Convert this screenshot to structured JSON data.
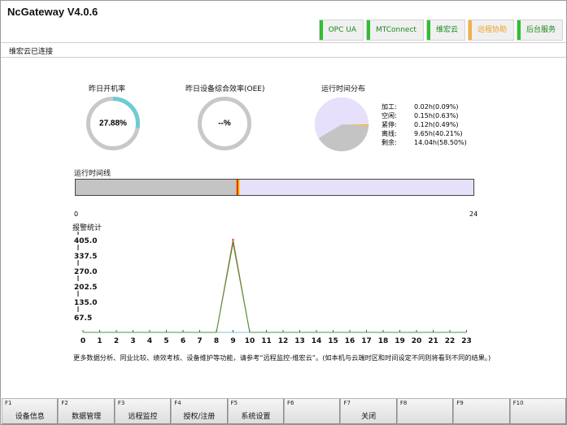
{
  "window": {
    "title": "NcGateway V4.0.6"
  },
  "header": {
    "tabs": [
      {
        "label": "OPC UA",
        "active": false
      },
      {
        "label": "MTConnect",
        "active": false
      },
      {
        "label": "维宏云",
        "active": false
      },
      {
        "label": "远程协助",
        "active": true
      },
      {
        "label": "后台服务",
        "active": false
      }
    ],
    "connection_status": "维宏云已连接"
  },
  "colors": {
    "tab_green": "#2fbf2f",
    "tab_orange": "#f7b040",
    "gauge_track": "#c8c8c8",
    "gauge_fill": "#6ecbd3",
    "idle_gray": "#c4c4c4",
    "remaining_lavender": "#e6e0fb",
    "alarm_red": "#e0522f",
    "alarm_green": "#3f9a3f",
    "baseline_teal": "#7ec3d3"
  },
  "dashboard": {
    "uptime": {
      "caption": "昨日开机率",
      "value_text": "27.88%",
      "fraction": 0.2788
    },
    "oee": {
      "caption": "昨日设备综合效率(OEE)",
      "value_text": "--%"
    },
    "distribution": {
      "caption": "运行时间分布",
      "items": [
        {
          "label": "加工:",
          "value": "0.02h(0.09%)",
          "hours": 0.02,
          "color": "#e03030"
        },
        {
          "label": "空闲:",
          "value": "0.15h(0.63%)",
          "hours": 0.15,
          "color": "#f0a020"
        },
        {
          "label": "紧停:",
          "value": "0.12h(0.49%)",
          "hours": 0.12,
          "color": "#f5d030"
        },
        {
          "label": "离线:",
          "value": "9.65h(40.21%)",
          "hours": 9.65,
          "color": "#c4c4c4"
        },
        {
          "label": "剩余:",
          "value": "14.04h(58.50%)",
          "hours": 14.04,
          "color": "#e6e0fb"
        }
      ]
    }
  },
  "timeline": {
    "caption": "运行时间线",
    "start_label": "0",
    "end_label": "24",
    "segments": [
      {
        "start": 0,
        "end": 9.65,
        "color": "#c4c4c4"
      },
      {
        "start": 9.65,
        "end": 9.72,
        "color": "#f0a020"
      },
      {
        "start": 9.72,
        "end": 9.8,
        "color": "#e03030"
      },
      {
        "start": 9.8,
        "end": 9.92,
        "color": "#f5d030"
      },
      {
        "start": 9.92,
        "end": 24,
        "color": "#e6e0fb"
      }
    ]
  },
  "chart_data": {
    "type": "line",
    "title": "报警统计",
    "xlabel": "",
    "ylabel": "",
    "x": [
      0,
      1,
      2,
      3,
      4,
      5,
      6,
      7,
      8,
      9,
      10,
      11,
      12,
      13,
      14,
      15,
      16,
      17,
      18,
      19,
      20,
      21,
      22,
      23
    ],
    "xlim": [
      0,
      23
    ],
    "ylim": [
      0,
      405
    ],
    "y_ticks": [
      "67.5",
      "135.0",
      "202.5",
      "270.0",
      "337.5",
      "405.0"
    ],
    "series": [
      {
        "color": "#e0522f",
        "values": [
          0,
          0,
          0,
          0,
          0,
          0,
          0,
          0,
          0,
          405,
          0,
          0,
          0,
          0,
          0,
          0,
          0,
          0,
          0,
          0,
          0,
          0,
          0,
          0
        ]
      },
      {
        "color": "#3f9a3f",
        "values": [
          0,
          0,
          0,
          0,
          0,
          0,
          0,
          0,
          0,
          390,
          0,
          0,
          0,
          0,
          0,
          0,
          0,
          0,
          0,
          0,
          0,
          0,
          0,
          0
        ]
      }
    ]
  },
  "footer": {
    "note": "更多数据分析、同业比较、绩效考核、设备维护等功能，请参考“远程监控-维宏云”。(如本机与云端时区和时间设定不同则将看到不同的结果。)",
    "fkeys": [
      {
        "code": "F1",
        "label": "设备信息"
      },
      {
        "code": "F2",
        "label": "数据管理"
      },
      {
        "code": "F3",
        "label": "远程监控"
      },
      {
        "code": "F4",
        "label": "授权/注册"
      },
      {
        "code": "F5",
        "label": "系统设置"
      },
      {
        "code": "F6",
        "label": ""
      },
      {
        "code": "F7",
        "label": "关闭"
      },
      {
        "code": "F8",
        "label": ""
      },
      {
        "code": "F9",
        "label": ""
      },
      {
        "code": "F10",
        "label": ""
      }
    ]
  }
}
